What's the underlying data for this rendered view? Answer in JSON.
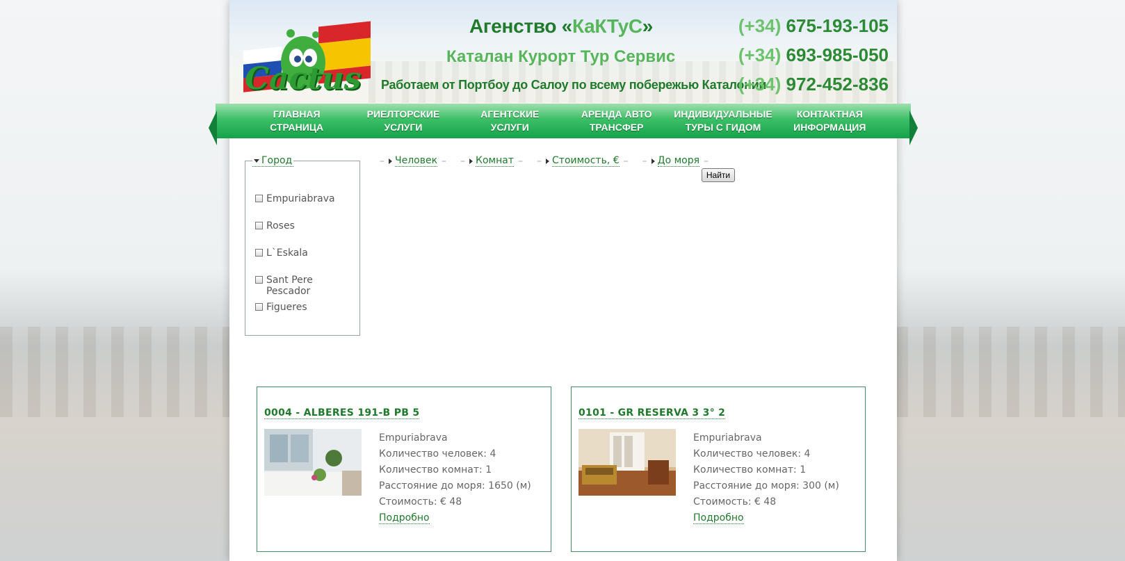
{
  "header": {
    "logo_text": "Cactus",
    "agency_title_prefix": "Агенство «",
    "agency_title_name": "КаКТуС",
    "agency_title_suffix": "»",
    "agency_subtitle": "Каталан Курорт Тур Сервис",
    "slogan": "Работаем от Портбоу до Салоу по всему побережью Каталонии",
    "phones": [
      {
        "code": "(+34)",
        "number": "675-193-105"
      },
      {
        "code": "(+34)",
        "number": "693-985-050"
      },
      {
        "code": "(+34)",
        "number": "972-452-836"
      }
    ]
  },
  "nav": {
    "items": [
      {
        "line1": "ГЛАВНАЯ",
        "line2": "СТРАНИЦА"
      },
      {
        "line1": "РИЕЛТОРСКИЕ",
        "line2": "УСЛУГИ"
      },
      {
        "line1": "АГЕНТСКИЕ",
        "line2": "УСЛУГИ"
      },
      {
        "line1": "АРЕНДА АВТО",
        "line2": "ТРАНСФЕР"
      },
      {
        "line1": "ИНДИВИДУАЛЬНЫЕ",
        "line2": "ТУРЫ С ГИДОМ"
      },
      {
        "line1": "КОНТАКТНАЯ",
        "line2": "ИНФОРМАЦИЯ"
      }
    ]
  },
  "filter": {
    "city_label": "Город",
    "cities": [
      "Empuriabrava",
      "Roses",
      "L`Eskala",
      "Sant Pere Pescador",
      "Figueres"
    ],
    "tabs": [
      "Человек",
      "Комнат",
      "Стоимость, €",
      "До моря"
    ],
    "search_button": "Найти"
  },
  "listings": [
    {
      "title": "0004 - ALBERES 191-B PB 5",
      "city": "Empuriabrava",
      "people": "Количество человек: 4",
      "rooms": "Количество комнат: 1",
      "distance": "Расстояние до моря: 1650 (м)",
      "price": "Стоимость: € 48",
      "more": "Подробно"
    },
    {
      "title": "0101 - GR RESERVA 3 3° 2",
      "city": "Empuriabrava",
      "people": "Количество человек: 4",
      "rooms": "Количество комнат: 1",
      "distance": "Расстояние до моря: 300 (м)",
      "price": "Стоимость: € 48",
      "more": "Подробно"
    }
  ],
  "colors": {
    "brand_green": "#1f7a2b",
    "light_green": "#57b65b",
    "nav_green": "#15a24a",
    "card_border": "#3e8d63"
  }
}
